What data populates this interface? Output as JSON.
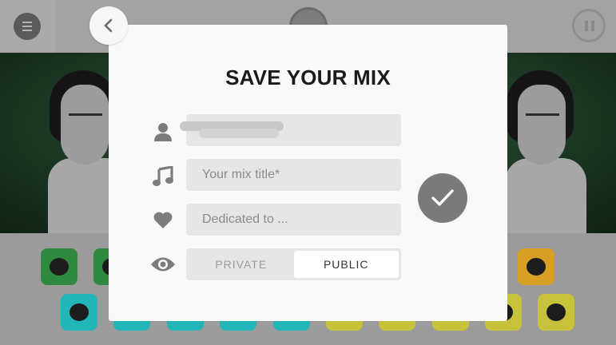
{
  "dialog": {
    "title": "SAVE YOUR MIX",
    "username": {
      "value": ""
    },
    "mix_title": {
      "placeholder": "Your mix title*",
      "value": ""
    },
    "dedicated": {
      "placeholder": "Dedicated to ...",
      "value": ""
    },
    "visibility": {
      "private_label": "PRIVATE",
      "public_label": "PUBLIC",
      "selected": "PUBLIC"
    }
  },
  "icons": {
    "menu": "hamburger-menu-icon",
    "back": "chevron-left-icon",
    "user": "user-icon",
    "music": "music-note-icon",
    "heart": "heart-icon",
    "eye": "eye-icon",
    "confirm": "checkmark-icon",
    "pause": "pause-icon"
  },
  "colors": {
    "dialog_bg": "#f9f9f9",
    "field_bg": "#e6e6e6",
    "confirm_bg": "#7a7a7a",
    "overlay_tone": "#9a9a9a"
  }
}
